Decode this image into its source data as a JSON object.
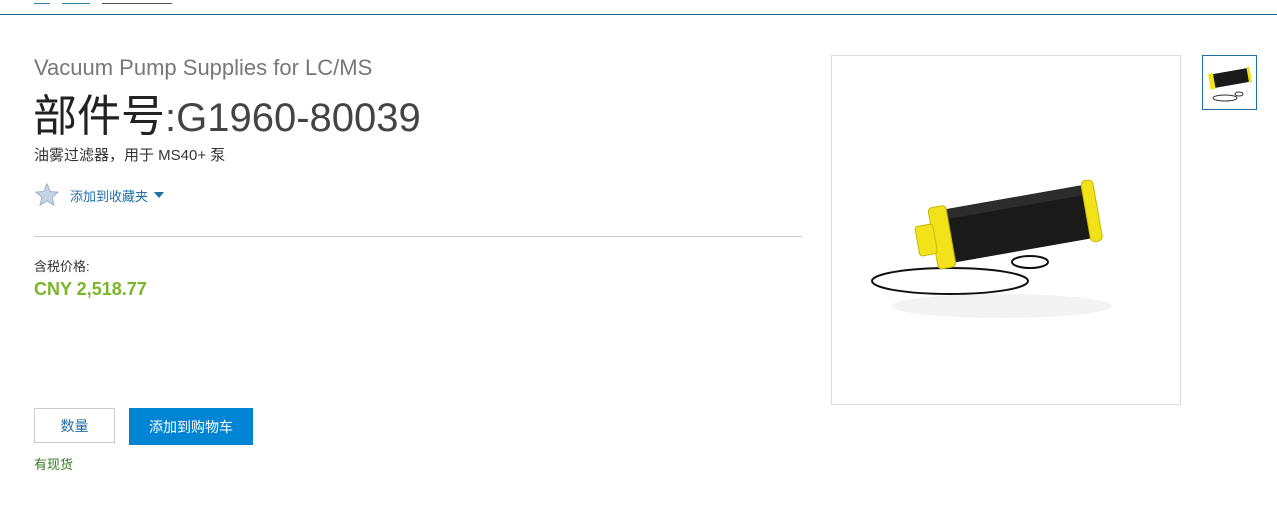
{
  "product": {
    "category": "Vacuum Pump Supplies for LC/MS",
    "part_label": "部件号",
    "part_colon": ":",
    "part_number": "G1960-80039",
    "description": "油雾过滤器，用于 MS40+ 泵",
    "favorites_label": "添加到收藏夹",
    "price_label": "含税价格:",
    "price": "CNY 2,518.77",
    "quantity_label": "数量",
    "add_to_cart_label": "添加到购物车",
    "stock_status": "有现货"
  },
  "icons": {
    "favorite": "star-icon",
    "dropdown": "caret-down-icon"
  },
  "colors": {
    "accent_blue": "#0085d5",
    "link_blue": "#1f6fa5",
    "price_green": "#7ab52a",
    "stock_green": "#2e7d1e",
    "filter_yellow": "#f2e21a"
  }
}
